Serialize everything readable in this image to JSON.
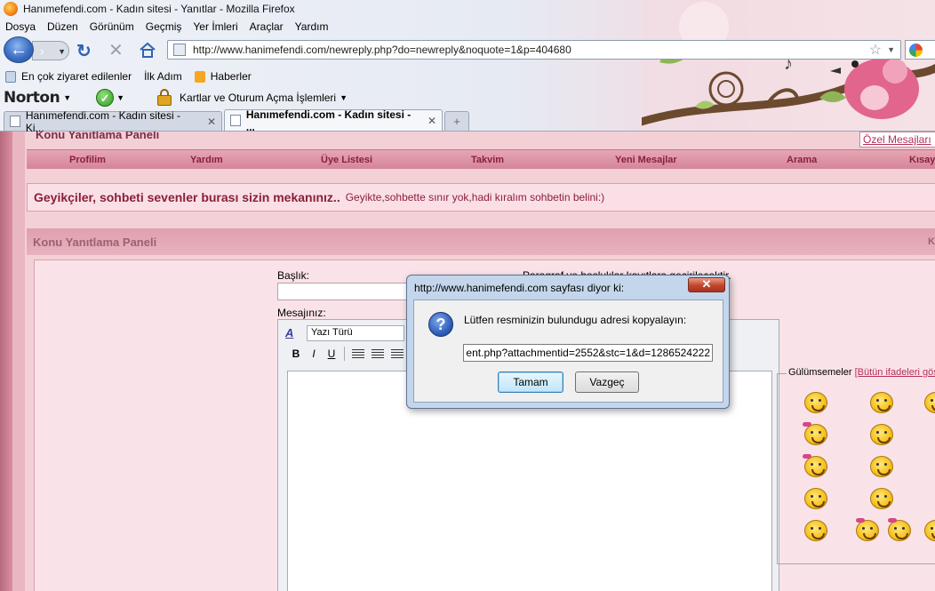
{
  "window": {
    "title": "Hanımefendi.com - Kadın sitesi - Yanıtlar - Mozilla Firefox"
  },
  "menu": [
    "Dosya",
    "Düzen",
    "Görünüm",
    "Geçmiş",
    "Yer İmleri",
    "Araçlar",
    "Yardım"
  ],
  "address": {
    "url": "http://www.hanimefendi.com/newreply.php?do=newreply&noquote=1&p=404680"
  },
  "bookmarks": [
    "En çok ziyaret edilenler",
    "İlk Adım",
    "Haberler"
  ],
  "norton": {
    "logo": "Norton",
    "card_label": "Kartlar ve Oturum Açma İşlemleri"
  },
  "tabs": [
    {
      "label": "Hanımefendi.com - Kadın sitesi - Ki...",
      "active": false
    },
    {
      "label": "Hanımefendi.com - Kadın sitesi - ...",
      "active": true
    }
  ],
  "page": {
    "top_title": "Konu Yanıtlama Paneli",
    "ozel_link": "Özel Mesajları",
    "nav": [
      "Profilim",
      "Yardım",
      "Üye Listesi",
      "Takvim",
      "Yeni Mesajlar",
      "Arama",
      "Kısay"
    ],
    "forum_title": "Geyikçiler, sohbeti sevenler burası sizin mekanınız..",
    "forum_desc": "Geyikte,sohbette sınır yok,hadi kıralım sohbetin belini:)",
    "panel_title": "Konu Yanıtlama Paneli",
    "panel_right": "K",
    "baslik_label": "Başlık:",
    "kayit_text": "kayıtlara geçirilecektir.",
    "mesaj_label": "Mesajınız:",
    "font_select": "Yazı Türü",
    "smilies_label": "Gülümsemeler",
    "smilies_link": "[Bütün ifadeleri göst"
  },
  "dialog": {
    "title": "http://www.hanimefendi.com sayfası diyor ki:",
    "message": "Lütfen resminizin bulundugu adresi kopyalayın:",
    "value": "ent.php?attachmentid=2552&stc=1&d=1286524222",
    "ok": "Tamam",
    "cancel": "Vazgeç"
  },
  "colors": {
    "nav_text": "#8a1f3f",
    "link": "#b3315a",
    "nav_band": "#d48597"
  }
}
